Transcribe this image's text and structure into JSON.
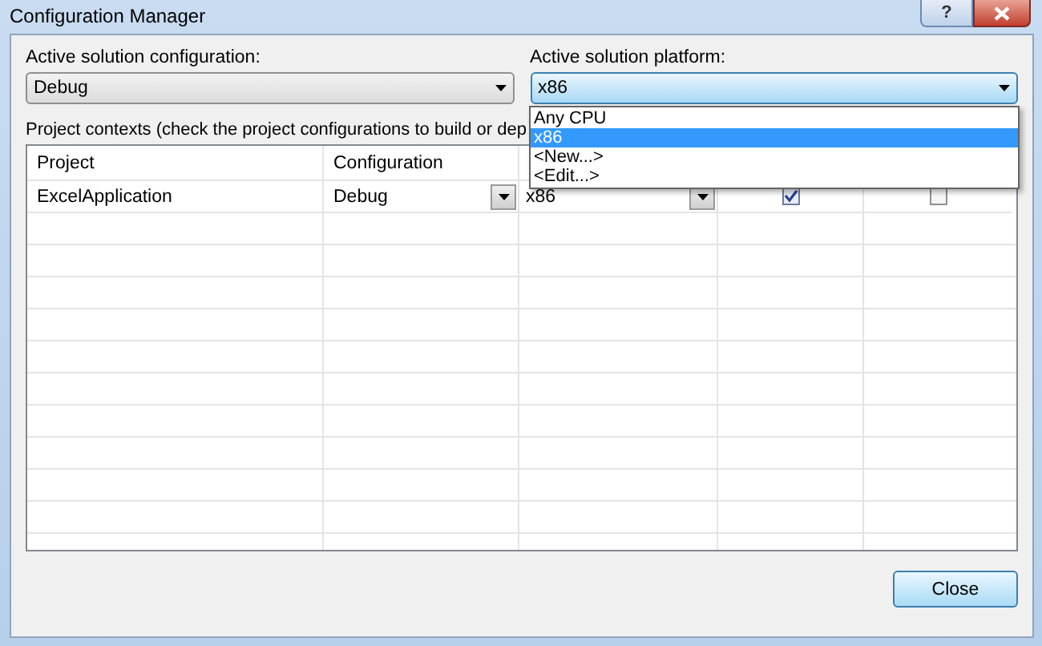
{
  "window": {
    "title": "Configuration Manager",
    "help_glyph": "?"
  },
  "active_configuration": {
    "label": "Active solution configuration:",
    "value": "Debug"
  },
  "active_platform": {
    "label": "Active solution platform:",
    "value": "x86",
    "expanded": true,
    "options": [
      {
        "label": "Any CPU",
        "selected": false
      },
      {
        "label": "x86",
        "selected": true
      },
      {
        "label": "<New...>",
        "selected": false
      },
      {
        "label": "<Edit...>",
        "selected": false
      }
    ]
  },
  "contexts_label": "Project contexts (check the project configurations to build or dep",
  "table": {
    "columns": [
      "Project",
      "Configuration"
    ],
    "rows": [
      {
        "project": "ExcelApplication",
        "configuration": "Debug",
        "platform": "x86",
        "build": true,
        "deploy": false
      }
    ]
  },
  "buttons": [
    "Close"
  ]
}
